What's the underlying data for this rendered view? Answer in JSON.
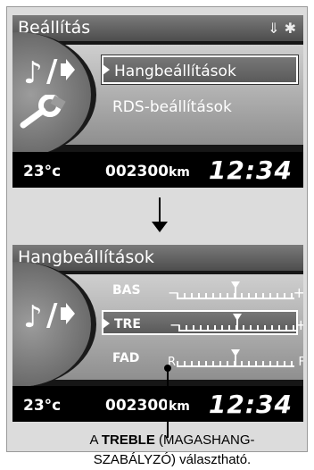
{
  "screen1": {
    "title": "Beállítás",
    "status_icons": "⇓ ✱",
    "menu_items": [
      {
        "label": "Hangbeállítások",
        "selected": true
      },
      {
        "label": "RDS-beállítások",
        "selected": false
      }
    ],
    "temperature": "23°c",
    "odometer": "002300",
    "odometer_unit": "km",
    "clock": "12:34"
  },
  "screen2": {
    "title": "Hangbeállítások",
    "rows": [
      {
        "label": "BAS",
        "left": "−",
        "right": "+",
        "level": 0.5,
        "selected": false
      },
      {
        "label": "TRE",
        "left": "−",
        "right": "+",
        "level": 0.5,
        "selected": true
      },
      {
        "label": "FAD",
        "left": "R",
        "right": "F",
        "level": 0.5,
        "selected": false
      }
    ],
    "temperature": "23°c",
    "odometer": "002300",
    "odometer_unit": "km",
    "clock": "12:34"
  },
  "caption": {
    "prefix": "A ",
    "bold": "TREBLE",
    "line1_rest": " (MAGASHANG-",
    "line2": "SZABÁLYZÓ) választható."
  },
  "colors": {
    "screen_bg": "#161616",
    "highlight": "#ffffff",
    "frame_bg": "#dcdcdc"
  }
}
